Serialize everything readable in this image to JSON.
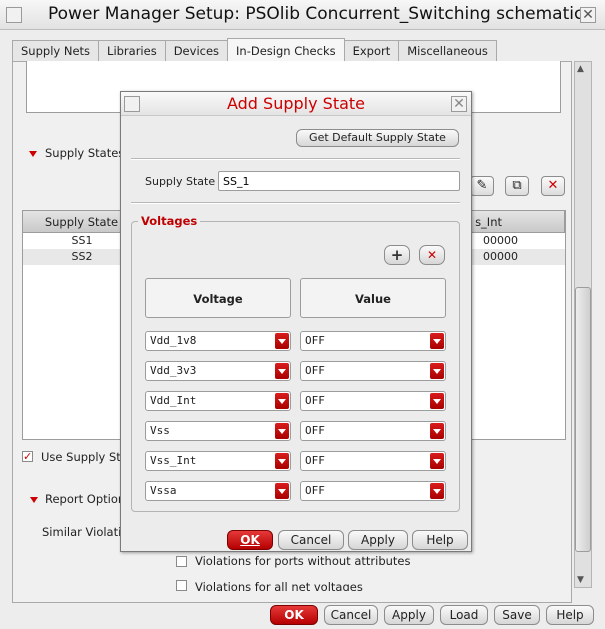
{
  "window": {
    "title": "Power Manager Setup: PSOlib Concurrent_Switching schematic"
  },
  "tabs": [
    {
      "label": "Supply Nets"
    },
    {
      "label": "Libraries"
    },
    {
      "label": "Devices"
    },
    {
      "label": "In-Design Checks"
    },
    {
      "label": "Export"
    },
    {
      "label": "Miscellaneous"
    }
  ],
  "main": {
    "supply_states_label": "Supply States",
    "table": {
      "col_supply_state": "Supply State",
      "col_right_partial": "s_Int",
      "rows": [
        {
          "state": "SS1",
          "right": "00000"
        },
        {
          "state": "SS2",
          "right": "00000"
        }
      ]
    },
    "use_supply_states_label": "Use Supply Sta",
    "report_options_label": "Report Optior",
    "similar_violations_label": "Similar Violatio",
    "violations_ports_label": "Violations for ports without attributes",
    "violations_all_label": "Violations for all net voltages"
  },
  "dialog": {
    "title": "Add Supply State",
    "get_default_label": "Get Default Supply State",
    "supply_state_label": "Supply State",
    "supply_state_value": "SS_1",
    "voltages_legend": "Voltages",
    "voltage_header": "Voltage",
    "value_header": "Value",
    "rows": [
      {
        "voltage": "Vdd_1v8",
        "value": "OFF"
      },
      {
        "voltage": "Vdd_3v3",
        "value": "OFF"
      },
      {
        "voltage": "Vdd_Int",
        "value": "OFF"
      },
      {
        "voltage": "Vss",
        "value": "OFF"
      },
      {
        "voltage": "Vss_Int",
        "value": "OFF"
      },
      {
        "voltage": "Vssa",
        "value": "OFF"
      }
    ],
    "buttons": {
      "ok": "OK",
      "cancel": "Cancel",
      "apply": "Apply",
      "help": "Help"
    }
  },
  "footer_buttons": {
    "ok": "OK",
    "cancel": "Cancel",
    "apply": "Apply",
    "load": "Load",
    "save": "Save",
    "help": "Help"
  }
}
